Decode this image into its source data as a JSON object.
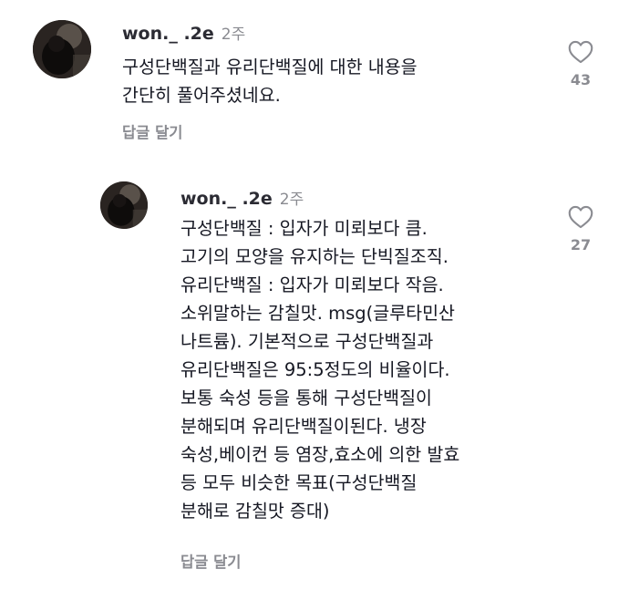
{
  "comments": [
    {
      "username": "won._ .2e",
      "time": "2주",
      "text": "구성단백질과 유리단백질에 대한 내용을\n간단히 풀어주셨네요.",
      "reply_label": "답글 달기",
      "like_icon": "heart-outline-icon",
      "like_count": "43"
    },
    {
      "username": "won._ .2e",
      "time": "2주",
      "text": "구성단백질 : 입자가 미뢰보다 큼.\n고기의 모양을 유지하는 단빅질조직.\n유리단백질 : 입자가 미뢰보다 작음.\n소위말하는 감칠맛. msg(글루타민산\n나트륨). 기본적으로 구성단백질과\n유리단백질은 95:5정도의 비율이다.\n보통 숙성 등을 통해 구성단백질이\n분해되며 유리단백질이된다.  냉장\n숙성,베이컨 등 염장,효소에 의한 발효\n등 모두 비슷한 목표(구성단백질\n분해로 감칠맛 증대)",
      "reply_label": "답글 달기",
      "like_icon": "heart-outline-icon",
      "like_count": "27"
    }
  ]
}
